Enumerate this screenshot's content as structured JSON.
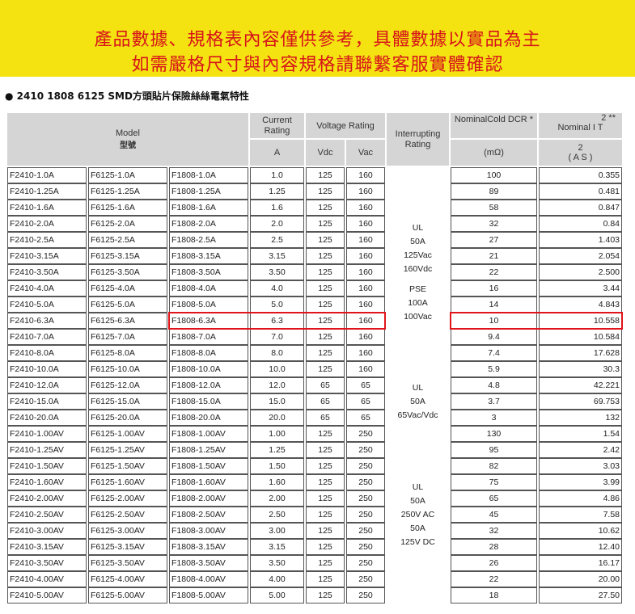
{
  "banner": {
    "line1": "產品數據、規格表內容僅供參考，具體數據以實品為主",
    "line2": "如需嚴格尺寸與內容規格請聯繫客服實體確認"
  },
  "heading": "● 2410 1808 6125 SMD方頭貼片保險絲絲電氣特性",
  "table": {
    "headers": {
      "model": "Model",
      "model_cn": "型號",
      "current": "Current Rating",
      "current_unit": "A",
      "voltage": "Voltage Rating",
      "vdc": "Vdc",
      "vac": "Vac",
      "interrupting": "Interrupting Rating",
      "dcr": "NominalCold DCR *",
      "dcr_unit": "(mΩ)",
      "i2t_top": "2  **",
      "i2t": "Nominal I  T",
      "i2t_unit_top": "2",
      "i2t_unit": "( A  S )"
    },
    "groups": [
      {
        "rating": [
          "UL",
          "50A",
          "125Vac",
          "160Vdc",
          "",
          "PSE",
          "100A",
          "100Vac"
        ],
        "rows": [
          [
            "F2410-1.0A",
            "F6125-1.0A",
            "F1808-1.0A",
            "1.0",
            "125",
            "160",
            "100",
            "0.355"
          ],
          [
            "F2410-1.25A",
            "F6125-1.25A",
            "F1808-1.25A",
            "1.25",
            "125",
            "160",
            "89",
            "0.481"
          ],
          [
            "F2410-1.6A",
            "F6125-1.6A",
            "F1808-1.6A",
            "1.6",
            "125",
            "160",
            "58",
            "0.847"
          ],
          [
            "F2410-2.0A",
            "F6125-2.0A",
            "F1808-2.0A",
            "2.0",
            "125",
            "160",
            "32",
            "0.84"
          ],
          [
            "F2410-2.5A",
            "F6125-2.5A",
            "F1808-2.5A",
            "2.5",
            "125",
            "160",
            "27",
            "1.403"
          ],
          [
            "F2410-3.15A",
            "F6125-3.15A",
            "F1808-3.15A",
            "3.15",
            "125",
            "160",
            "21",
            "2.054"
          ],
          [
            "F2410-3.50A",
            "F6125-3.50A",
            "F1808-3.50A",
            "3.50",
            "125",
            "160",
            "22",
            "2.500"
          ],
          [
            "F2410-4.0A",
            "F6125-4.0A",
            "F1808-4.0A",
            "4.0",
            "125",
            "160",
            "16",
            "3.44"
          ],
          [
            "F2410-5.0A",
            "F6125-5.0A",
            "F1808-5.0A",
            "5.0",
            "125",
            "160",
            "14",
            "4.843"
          ],
          [
            "F2410-6.3A",
            "F6125-6.3A",
            "F1808-6.3A",
            "6.3",
            "125",
            "160",
            "10",
            "10.558"
          ],
          [
            "F2410-7.0A",
            "F6125-7.0A",
            "F1808-7.0A",
            "7.0",
            "125",
            "160",
            "9.4",
            "10.584"
          ],
          [
            "F2410-8.0A",
            "F6125-8.0A",
            "F1808-8.0A",
            "8.0",
            "125",
            "160",
            "7.4",
            "17.628"
          ],
          [
            "F2410-10.0A",
            "F6125-10.0A",
            "F1808-10.0A",
            "10.0",
            "125",
            "160",
            "5.9",
            "30.3"
          ]
        ]
      },
      {
        "rating": [
          "UL",
          "50A",
          "65Vac/Vdc"
        ],
        "rows": [
          [
            "F2410-12.0A",
            "F6125-12.0A",
            "F1808-12.0A",
            "12.0",
            "65",
            "65",
            "4.8",
            "42.221"
          ],
          [
            "F2410-15.0A",
            "F6125-15.0A",
            "F1808-15.0A",
            "15.0",
            "65",
            "65",
            "3.7",
            "69.753"
          ],
          [
            "F2410-20.0A",
            "F6125-20.0A",
            "F1808-20.0A",
            "20.0",
            "65",
            "65",
            "3",
            "132"
          ]
        ]
      },
      {
        "rating": [
          "UL",
          "50A",
          "250V AC",
          "50A",
          "125V DC"
        ],
        "rows": [
          [
            "F2410-1.00AV",
            "F6125-1.00AV",
            "F1808-1.00AV",
            "1.00",
            "125",
            "250",
            "130",
            "1.54"
          ],
          [
            "F2410-1.25AV",
            "F6125-1.25AV",
            "F1808-1.25AV",
            "1.25",
            "125",
            "250",
            "95",
            "2.42"
          ],
          [
            "F2410-1.50AV",
            "F6125-1.50AV",
            "F1808-1.50AV",
            "1.50",
            "125",
            "250",
            "82",
            "3.03"
          ],
          [
            "F2410-1.60AV",
            "F6125-1.60AV",
            "F1808-1.60AV",
            "1.60",
            "125",
            "250",
            "75",
            "3.99"
          ],
          [
            "F2410-2.00AV",
            "F6125-2.00AV",
            "F1808-2.00AV",
            "2.00",
            "125",
            "250",
            "65",
            "4.86"
          ],
          [
            "F2410-2.50AV",
            "F6125-2.50AV",
            "F1808-2.50AV",
            "2.50",
            "125",
            "250",
            "45",
            "7.58"
          ],
          [
            "F2410-3.00AV",
            "F6125-3.00AV",
            "F1808-3.00AV",
            "3.00",
            "125",
            "250",
            "32",
            "10.62"
          ],
          [
            "F2410-3.15AV",
            "F6125-3.15AV",
            "F1808-3.15AV",
            "3.15",
            "125",
            "250",
            "28",
            "12.40"
          ],
          [
            "F2410-3.50AV",
            "F6125-3.50AV",
            "F1808-3.50AV",
            "3.50",
            "125",
            "250",
            "26",
            "16.17"
          ],
          [
            "F2410-4.00AV",
            "F6125-4.00AV",
            "F1808-4.00AV",
            "4.00",
            "125",
            "250",
            "22",
            "20.00"
          ],
          [
            "F2410-5.00AV",
            "F6125-5.00AV",
            "F1808-5.00AV",
            "5.00",
            "125",
            "250",
            "18",
            "27.50"
          ]
        ]
      }
    ],
    "highlight_color": "#e0141b"
  }
}
